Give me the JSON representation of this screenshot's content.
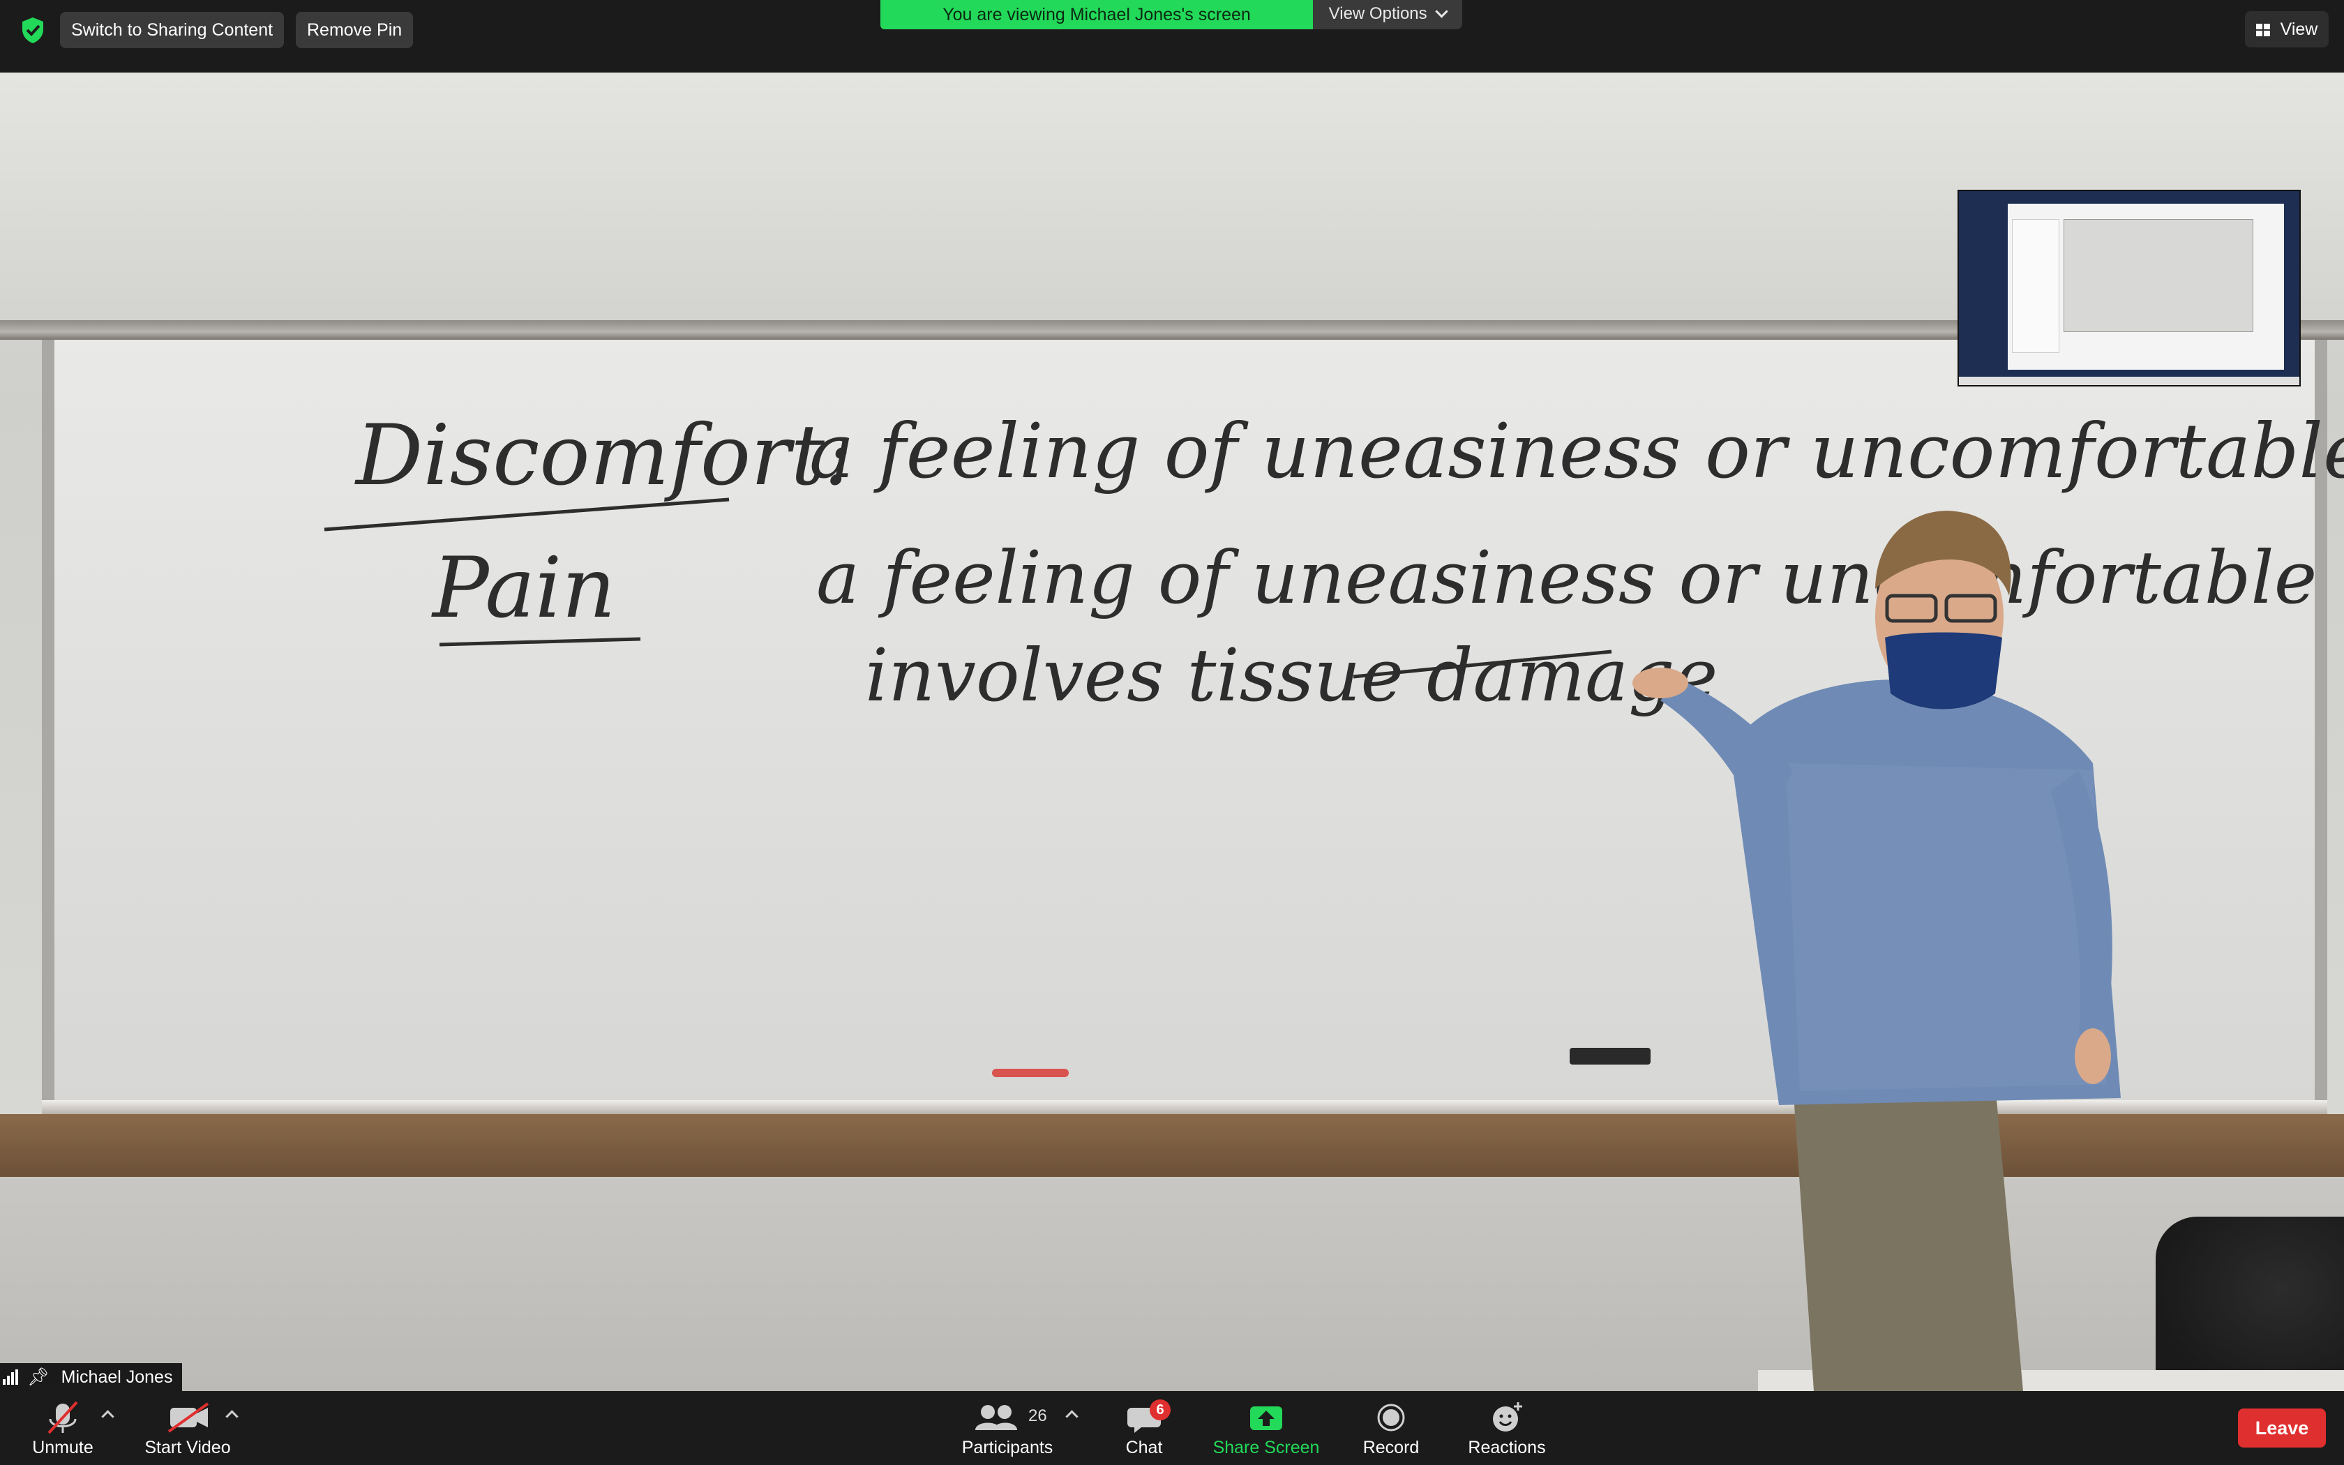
{
  "top_bar": {
    "switch_sharing_label": "Switch to Sharing Content",
    "remove_pin_label": "Remove Pin",
    "viewing_banner": "You are viewing Michael Jones's screen",
    "view_options_label": "View Options",
    "view_label": "View"
  },
  "whiteboard": {
    "line1_term": "Discomfort:",
    "line1_def": "a feeling of uneasiness or uncomfortable.",
    "line2_term": "Pain",
    "line2_def": "a feeling of uneasiness or uncomfortable",
    "line3": "involves tissue damage"
  },
  "participant": {
    "name": "Michael Jones"
  },
  "toolbar": {
    "unmute_label": "Unmute",
    "start_video_label": "Start Video",
    "participants_label": "Participants",
    "participants_count": "26",
    "chat_label": "Chat",
    "chat_badge": "6",
    "share_screen_label": "Share Screen",
    "record_label": "Record",
    "reactions_label": "Reactions",
    "leave_label": "Leave"
  },
  "colors": {
    "banner_green": "#23d959",
    "leave_red": "#e02f2f",
    "toolbar_bg": "#1b1b1b"
  },
  "icons": [
    "shield-check-icon",
    "chevron-down-icon",
    "grid-view-icon",
    "signal-bars-icon",
    "pin-icon",
    "muted-mic-icon",
    "video-off-icon",
    "participants-icon",
    "chat-bubble-icon",
    "share-screen-arrow-icon",
    "record-icon",
    "reactions-smiley-icon"
  ]
}
